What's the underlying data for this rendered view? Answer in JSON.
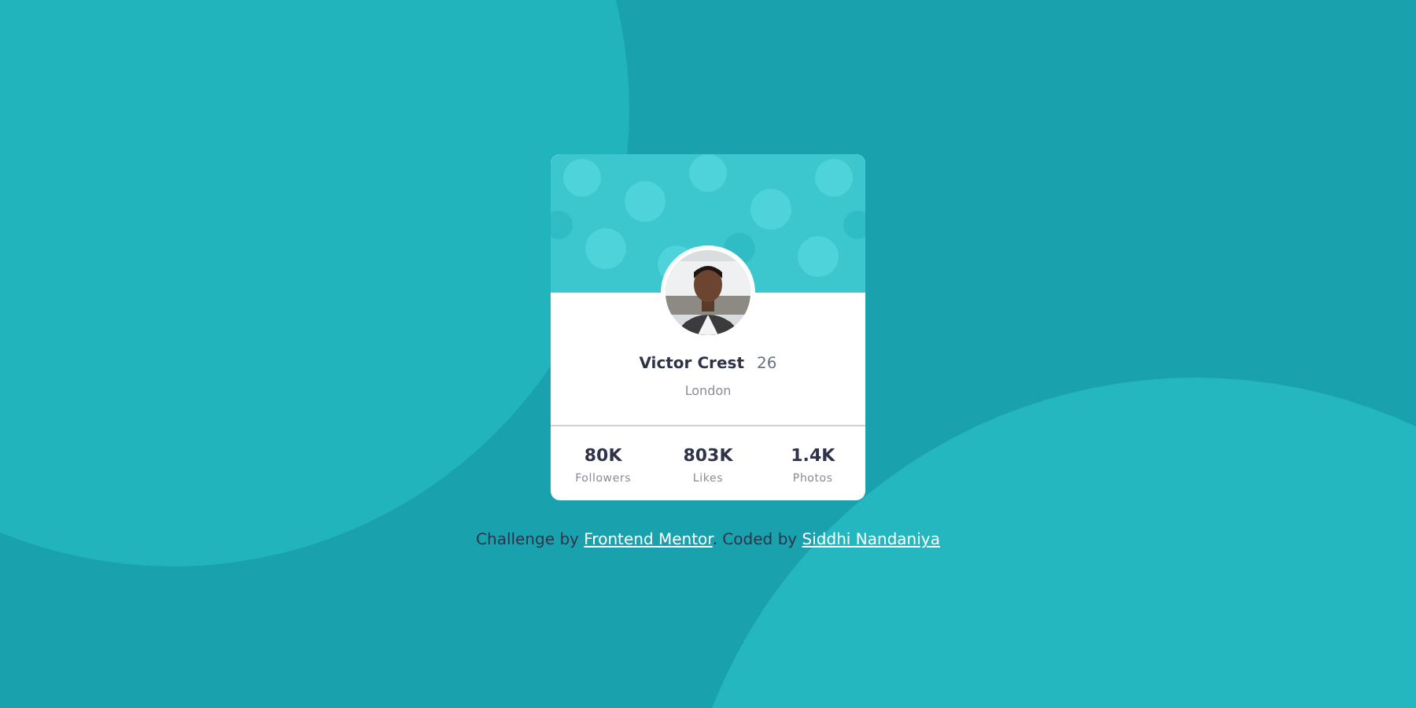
{
  "profile": {
    "name": "Victor Crest",
    "age": "26",
    "city": "London"
  },
  "stats": [
    {
      "value": "80K",
      "label": "Followers"
    },
    {
      "value": "803K",
      "label": "Likes"
    },
    {
      "value": "1.4K",
      "label": "Photos"
    }
  ],
  "attribution": [
    {
      "kind": "text",
      "text": "Challenge by"
    },
    {
      "kind": "link",
      "text": "Frontend Mentor"
    },
    {
      "kind": "text",
      "text": ". Coded by"
    },
    {
      "kind": "link",
      "text": "Siddhi Nandaniya"
    }
  ]
}
